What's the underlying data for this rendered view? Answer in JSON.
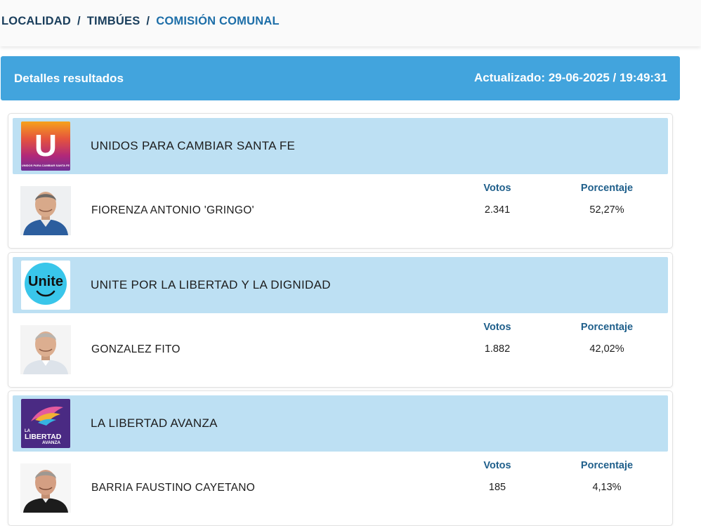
{
  "breadcrumb": {
    "items": [
      "LOCALIDAD",
      "TIMBÚES",
      "COMISIÓN COMUNAL"
    ],
    "separator": "/"
  },
  "header": {
    "title": "Detalles resultados",
    "updated": "Actualizado: 29-06-2025 / 19:49:31"
  },
  "columns": {
    "votes": "Votos",
    "percent": "Porcentaje"
  },
  "results": [
    {
      "party": "UNIDOS PARA CAMBIAR SANTA FE",
      "party_logo": {
        "letter": "U",
        "caption": "UNIDOS PARA CAMBIAR SANTA FE"
      },
      "candidate": "FIORENZA ANTONIO 'GRINGO'",
      "votes": "2.341",
      "percent": "52,27%"
    },
    {
      "party": "UNITE POR LA LIBERTAD Y LA DIGNIDAD",
      "party_logo": {
        "text": "Unite"
      },
      "candidate": "GONZALEZ FITO",
      "votes": "1.882",
      "percent": "42,02%"
    },
    {
      "party": "LA LIBERTAD AVANZA",
      "party_logo": {
        "line1": "LA",
        "line2": "LIBERTAD",
        "line3": "AVANZA"
      },
      "candidate": "BARRIA FAUSTINO CAYETANO",
      "votes": "185",
      "percent": "4,13%"
    }
  ],
  "colors": {
    "header_bar": "#42a4dd",
    "party_row": "#bde0f3",
    "breadcrumb_text": "#1a3e5c",
    "breadcrumb_active": "#1d6ea8",
    "column_header": "#1f5f8b"
  }
}
